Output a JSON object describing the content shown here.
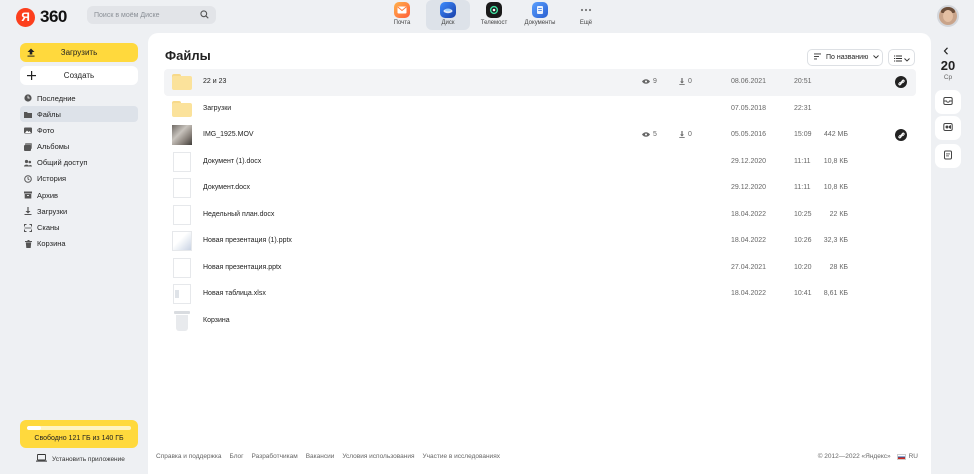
{
  "header": {
    "logo_letter": "Я",
    "logo_text": "360",
    "search_placeholder": "Поиск в моём Диске",
    "services": [
      {
        "label": "Почта",
        "icon": "mail-icon",
        "color": "#ff8a3d"
      },
      {
        "label": "Диск",
        "icon": "disk-icon",
        "color": "#1f5fd8"
      },
      {
        "label": "Телемост",
        "icon": "telemost-icon",
        "color": "#1a1a1a"
      },
      {
        "label": "Документы",
        "icon": "documents-icon",
        "color": "#3b7ce6"
      },
      {
        "label": "Ещё",
        "icon": "more-icon",
        "color": "#888888"
      }
    ],
    "active_service": "Диск"
  },
  "sidebar": {
    "upload_label": "Загрузить",
    "create_label": "Создать",
    "items": [
      {
        "label": "Последние",
        "icon": "clock-icon"
      },
      {
        "label": "Файлы",
        "icon": "folder-icon"
      },
      {
        "label": "Фото",
        "icon": "photo-icon"
      },
      {
        "label": "Альбомы",
        "icon": "album-icon"
      },
      {
        "label": "Общий доступ",
        "icon": "shared-icon"
      },
      {
        "label": "История",
        "icon": "history-icon"
      },
      {
        "label": "Архив",
        "icon": "archive-icon"
      },
      {
        "label": "Загрузки",
        "icon": "download-icon"
      },
      {
        "label": "Сканы",
        "icon": "scan-icon"
      },
      {
        "label": "Корзина",
        "icon": "trash-icon"
      }
    ],
    "active_item": "Файлы",
    "storage_text": "Свободно 121 ГБ из 140 ГБ",
    "storage_used_fraction": 0.136,
    "install_app_label": "Установить приложение"
  },
  "main": {
    "title": "Файлы",
    "sort_label": "По названию",
    "rows": [
      {
        "name": "22 и 23",
        "type": "folder",
        "views": "9",
        "downloads": "0",
        "date": "08.06.2021",
        "time": "20:51",
        "size": "",
        "shared": true
      },
      {
        "name": "Загрузки",
        "type": "folder",
        "views": "",
        "downloads": "",
        "date": "07.05.2018",
        "time": "22:31",
        "size": "",
        "shared": false
      },
      {
        "name": "IMG_1925.MOV",
        "type": "photo",
        "views": "5",
        "downloads": "0",
        "date": "05.05.2016",
        "time": "15:09",
        "size": "442 МБ",
        "shared": true
      },
      {
        "name": "Документ (1).docx",
        "type": "doc",
        "views": "",
        "downloads": "",
        "date": "29.12.2020",
        "time": "11:11",
        "size": "10,8 КБ",
        "shared": false
      },
      {
        "name": "Документ.docx",
        "type": "doc",
        "views": "",
        "downloads": "",
        "date": "29.12.2020",
        "time": "11:11",
        "size": "10,8 КБ",
        "shared": false
      },
      {
        "name": "Недельный план.docx",
        "type": "doc",
        "views": "",
        "downloads": "",
        "date": "18.04.2022",
        "time": "10:25",
        "size": "22 КБ",
        "shared": false
      },
      {
        "name": "Новая презентация (1).pptx",
        "type": "pres",
        "views": "",
        "downloads": "",
        "date": "18.04.2022",
        "time": "10:26",
        "size": "32,3 КБ",
        "shared": false
      },
      {
        "name": "Новая презентация.pptx",
        "type": "doc",
        "views": "",
        "downloads": "",
        "date": "27.04.2021",
        "time": "10:20",
        "size": "28 КБ",
        "shared": false
      },
      {
        "name": "Новая таблица.xlsx",
        "type": "xls",
        "views": "",
        "downloads": "",
        "date": "18.04.2022",
        "time": "10:41",
        "size": "8,61 КБ",
        "shared": false
      },
      {
        "name": "Корзина",
        "type": "trash",
        "views": "",
        "downloads": "",
        "date": "",
        "time": "",
        "size": "",
        "shared": false
      }
    ]
  },
  "footer": {
    "links": [
      "Справка и поддержка",
      "Блог",
      "Разработчикам",
      "Вакансии",
      "Условия использования",
      "Участие в исследованиях"
    ],
    "copyright": "© 2012—2022 «Яндекс»",
    "lang": "RU"
  },
  "rightpanel": {
    "day": "20",
    "weekday": "Ср"
  }
}
